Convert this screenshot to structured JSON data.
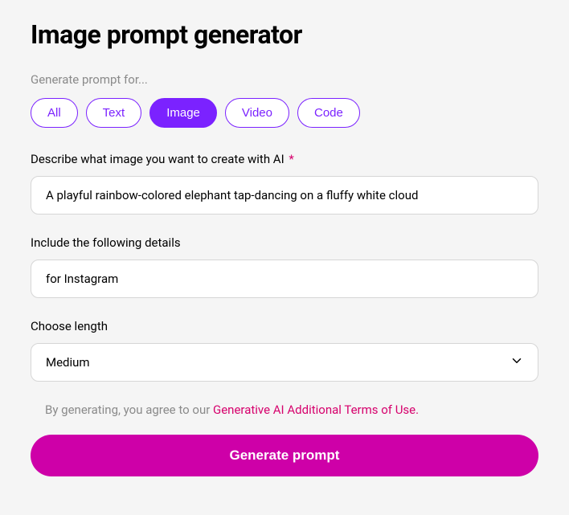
{
  "title": "Image prompt generator",
  "section_label": "Generate prompt for...",
  "tabs": {
    "all": "All",
    "text": "Text",
    "image": "Image",
    "video": "Video",
    "code": "Code",
    "active": "image"
  },
  "describe": {
    "label": "Describe what image you want to create with AI",
    "required_marker": "*",
    "value": "A playful rainbow-colored elephant tap-dancing on a fluffy white cloud"
  },
  "details": {
    "label": "Include the following details",
    "value": "for Instagram"
  },
  "length": {
    "label": "Choose length",
    "value": "Medium"
  },
  "terms": {
    "prefix": "By generating, you agree to our ",
    "link": "Generative AI Additional Terms of Use."
  },
  "generate_label": "Generate prompt"
}
